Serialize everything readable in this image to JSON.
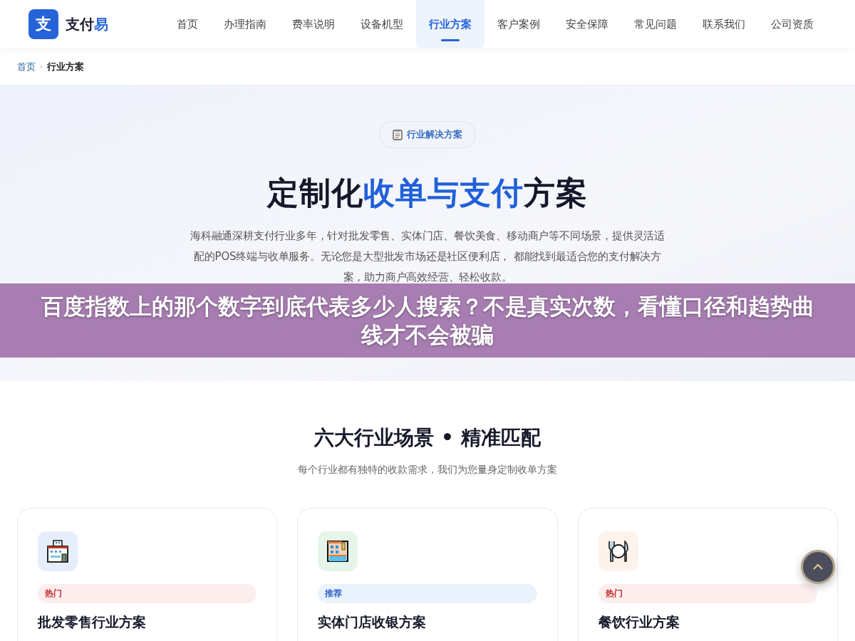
{
  "header": {
    "logo_mark": "支",
    "logo_parts": [
      {
        "text": "支付",
        "highlight": false
      },
      {
        "text": "易",
        "highlight": true
      }
    ],
    "nav": [
      {
        "label": "首页",
        "selected": false
      },
      {
        "label": "办理指南",
        "selected": false
      },
      {
        "label": "费率说明",
        "selected": false
      },
      {
        "label": "设备机型",
        "selected": false
      },
      {
        "label": "行业方案",
        "selected": true
      },
      {
        "label": "客户案例",
        "selected": false
      },
      {
        "label": "安全保障",
        "selected": false
      },
      {
        "label": "常见问题",
        "selected": false
      },
      {
        "label": "联系我们",
        "selected": false
      },
      {
        "label": "公司资质",
        "selected": false
      }
    ]
  },
  "breadcrumb": {
    "link": "首页",
    "separator": "›",
    "current": "行业方案"
  },
  "hero": {
    "badge": "行业解决方案",
    "title_parts": [
      {
        "text": "定制化",
        "highlight": false
      },
      {
        "text": "收单与支付",
        "highlight": true
      },
      {
        "text": "方案",
        "highlight": false
      }
    ],
    "description": "海科融通深耕支付行业多年，针对批发零售、实体门店、餐饮美食、移动商户等不同场景，提供灵活适配的POS终端与收单服务。无论您是大型批发市场还是社区便利店， 都能找到最适合您的支付解决方案，助力商户高效经营、轻松收款。"
  },
  "banner": {
    "text": "百度指数上的那个数字到底代表多少人搜索？不是真实次数，看懂口径和趋势曲线才不会被骗"
  },
  "section": {
    "title": "六大行业场景 • 精准匹配",
    "subtitle": "每个行业都有独特的收款需求，我们为您量身定制收单方案",
    "cards": [
      {
        "tag": "热门",
        "kind": "hot",
        "title": "批发零售行业方案"
      },
      {
        "tag": "推荐",
        "kind": "recommend",
        "title": "实体门店收银方案"
      },
      {
        "tag": "热门",
        "kind": "hot",
        "title": "餐饮行业方案"
      }
    ]
  }
}
